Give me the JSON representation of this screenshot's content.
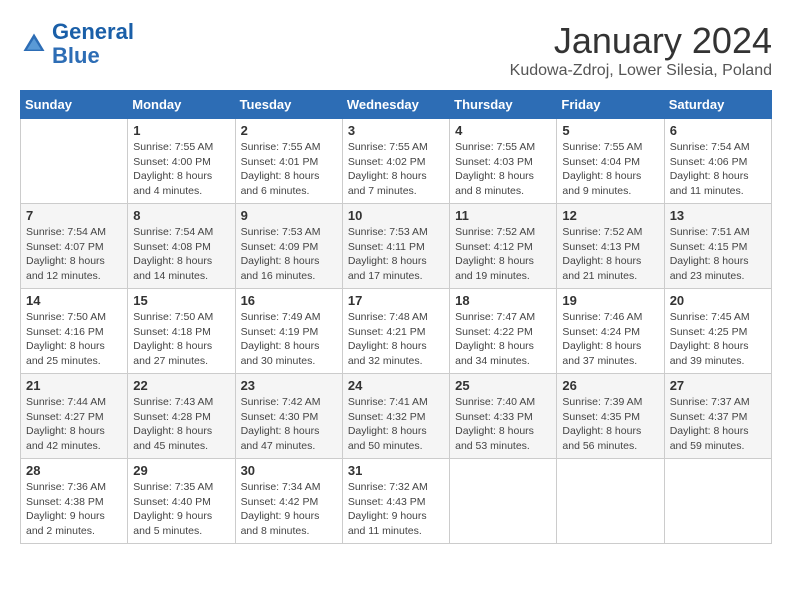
{
  "header": {
    "logo_line1": "General",
    "logo_line2": "Blue",
    "title": "January 2024",
    "subtitle": "Kudowa-Zdroj, Lower Silesia, Poland"
  },
  "columns": [
    "Sunday",
    "Monday",
    "Tuesday",
    "Wednesday",
    "Thursday",
    "Friday",
    "Saturday"
  ],
  "weeks": [
    [
      {
        "num": "",
        "info": ""
      },
      {
        "num": "1",
        "info": "Sunrise: 7:55 AM\nSunset: 4:00 PM\nDaylight: 8 hours\nand 4 minutes."
      },
      {
        "num": "2",
        "info": "Sunrise: 7:55 AM\nSunset: 4:01 PM\nDaylight: 8 hours\nand 6 minutes."
      },
      {
        "num": "3",
        "info": "Sunrise: 7:55 AM\nSunset: 4:02 PM\nDaylight: 8 hours\nand 7 minutes."
      },
      {
        "num": "4",
        "info": "Sunrise: 7:55 AM\nSunset: 4:03 PM\nDaylight: 8 hours\nand 8 minutes."
      },
      {
        "num": "5",
        "info": "Sunrise: 7:55 AM\nSunset: 4:04 PM\nDaylight: 8 hours\nand 9 minutes."
      },
      {
        "num": "6",
        "info": "Sunrise: 7:54 AM\nSunset: 4:06 PM\nDaylight: 8 hours\nand 11 minutes."
      }
    ],
    [
      {
        "num": "7",
        "info": "Sunrise: 7:54 AM\nSunset: 4:07 PM\nDaylight: 8 hours\nand 12 minutes."
      },
      {
        "num": "8",
        "info": "Sunrise: 7:54 AM\nSunset: 4:08 PM\nDaylight: 8 hours\nand 14 minutes."
      },
      {
        "num": "9",
        "info": "Sunrise: 7:53 AM\nSunset: 4:09 PM\nDaylight: 8 hours\nand 16 minutes."
      },
      {
        "num": "10",
        "info": "Sunrise: 7:53 AM\nSunset: 4:11 PM\nDaylight: 8 hours\nand 17 minutes."
      },
      {
        "num": "11",
        "info": "Sunrise: 7:52 AM\nSunset: 4:12 PM\nDaylight: 8 hours\nand 19 minutes."
      },
      {
        "num": "12",
        "info": "Sunrise: 7:52 AM\nSunset: 4:13 PM\nDaylight: 8 hours\nand 21 minutes."
      },
      {
        "num": "13",
        "info": "Sunrise: 7:51 AM\nSunset: 4:15 PM\nDaylight: 8 hours\nand 23 minutes."
      }
    ],
    [
      {
        "num": "14",
        "info": "Sunrise: 7:50 AM\nSunset: 4:16 PM\nDaylight: 8 hours\nand 25 minutes."
      },
      {
        "num": "15",
        "info": "Sunrise: 7:50 AM\nSunset: 4:18 PM\nDaylight: 8 hours\nand 27 minutes."
      },
      {
        "num": "16",
        "info": "Sunrise: 7:49 AM\nSunset: 4:19 PM\nDaylight: 8 hours\nand 30 minutes."
      },
      {
        "num": "17",
        "info": "Sunrise: 7:48 AM\nSunset: 4:21 PM\nDaylight: 8 hours\nand 32 minutes."
      },
      {
        "num": "18",
        "info": "Sunrise: 7:47 AM\nSunset: 4:22 PM\nDaylight: 8 hours\nand 34 minutes."
      },
      {
        "num": "19",
        "info": "Sunrise: 7:46 AM\nSunset: 4:24 PM\nDaylight: 8 hours\nand 37 minutes."
      },
      {
        "num": "20",
        "info": "Sunrise: 7:45 AM\nSunset: 4:25 PM\nDaylight: 8 hours\nand 39 minutes."
      }
    ],
    [
      {
        "num": "21",
        "info": "Sunrise: 7:44 AM\nSunset: 4:27 PM\nDaylight: 8 hours\nand 42 minutes."
      },
      {
        "num": "22",
        "info": "Sunrise: 7:43 AM\nSunset: 4:28 PM\nDaylight: 8 hours\nand 45 minutes."
      },
      {
        "num": "23",
        "info": "Sunrise: 7:42 AM\nSunset: 4:30 PM\nDaylight: 8 hours\nand 47 minutes."
      },
      {
        "num": "24",
        "info": "Sunrise: 7:41 AM\nSunset: 4:32 PM\nDaylight: 8 hours\nand 50 minutes."
      },
      {
        "num": "25",
        "info": "Sunrise: 7:40 AM\nSunset: 4:33 PM\nDaylight: 8 hours\nand 53 minutes."
      },
      {
        "num": "26",
        "info": "Sunrise: 7:39 AM\nSunset: 4:35 PM\nDaylight: 8 hours\nand 56 minutes."
      },
      {
        "num": "27",
        "info": "Sunrise: 7:37 AM\nSunset: 4:37 PM\nDaylight: 8 hours\nand 59 minutes."
      }
    ],
    [
      {
        "num": "28",
        "info": "Sunrise: 7:36 AM\nSunset: 4:38 PM\nDaylight: 9 hours\nand 2 minutes."
      },
      {
        "num": "29",
        "info": "Sunrise: 7:35 AM\nSunset: 4:40 PM\nDaylight: 9 hours\nand 5 minutes."
      },
      {
        "num": "30",
        "info": "Sunrise: 7:34 AM\nSunset: 4:42 PM\nDaylight: 9 hours\nand 8 minutes."
      },
      {
        "num": "31",
        "info": "Sunrise: 7:32 AM\nSunset: 4:43 PM\nDaylight: 9 hours\nand 11 minutes."
      },
      {
        "num": "",
        "info": ""
      },
      {
        "num": "",
        "info": ""
      },
      {
        "num": "",
        "info": ""
      }
    ]
  ]
}
